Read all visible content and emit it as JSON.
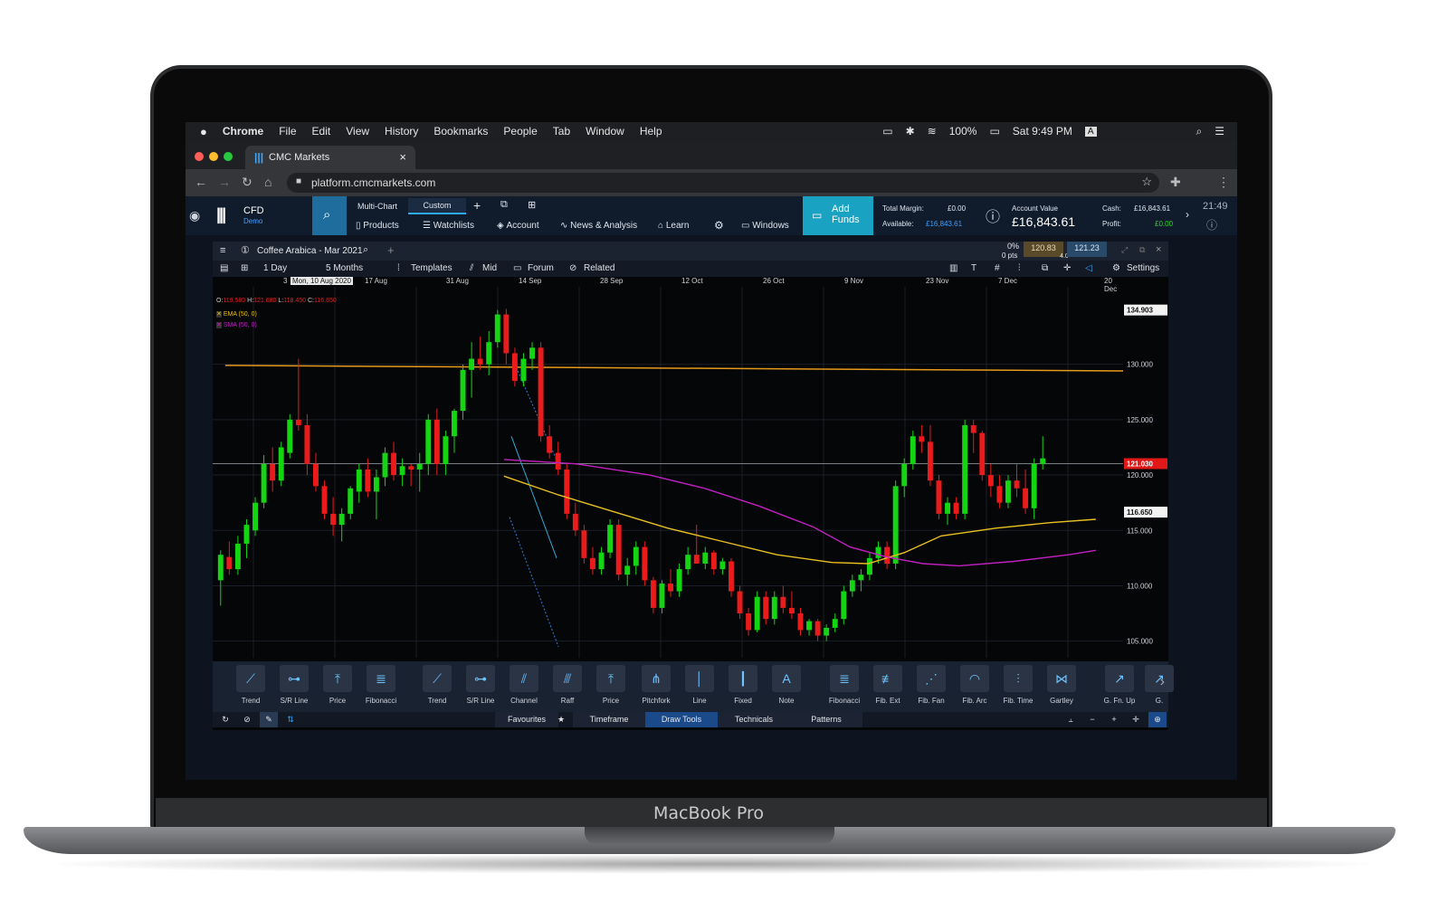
{
  "device": {
    "brand": "MacBook Pro"
  },
  "mac_menu": {
    "apple": "",
    "items": [
      "Chrome",
      "File",
      "Edit",
      "View",
      "History",
      "Bookmarks",
      "People",
      "Tab",
      "Window",
      "Help"
    ],
    "battery": "100%",
    "clock": "Sat 9:49 PM",
    "input": "A"
  },
  "browser": {
    "tab_title": "CMC Markets",
    "tab_close": "×",
    "url": "platform.cmcmarkets.com"
  },
  "cmc_header": {
    "account_type": "CFD",
    "account_mode": "Demo",
    "top_tabs": [
      "Multi-Chart",
      "Custom"
    ],
    "nav": [
      "Products",
      "Watchlists",
      "Account",
      "News & Analysis",
      "Learn",
      "Windows"
    ],
    "add_funds": "Add Funds",
    "total_margin_label": "Total Margin:",
    "total_margin_value": "£0.00",
    "available_label": "Available:",
    "available_value": "£16,843.61",
    "account_value_label": "Account Value",
    "account_value": "£16,843.61",
    "cash_label": "Cash:",
    "cash_value": "£16,843.61",
    "profit_label": "Profit:",
    "profit_value": "£0.00",
    "time": "21:49"
  },
  "chart_window": {
    "instrument": "Coffee Arabica - Mar 2021",
    "change_pct": "0%",
    "change_pts": "0 pts",
    "sell_price": "120.83",
    "buy_price": "121.23",
    "spread": "4.0",
    "toolbar": [
      "1 Day",
      "5 Months",
      "Templates",
      "Mid",
      "Forum",
      "Related",
      "Settings"
    ],
    "date_labels": [
      "3",
      "Mon, 10 Aug 2020",
      "17 Aug",
      "31 Aug",
      "14 Sep",
      "28 Sep",
      "12 Oct",
      "26 Oct",
      "9 Nov",
      "23 Nov",
      "7 Dec",
      "20 Dec"
    ],
    "ohlc": {
      "o_label": "O:",
      "o": "119.580",
      "h_label": "H:",
      "h": "121.680",
      "l_label": "L:",
      "l": "118.450",
      "c_label": "C:",
      "c": "116.650"
    },
    "indicators": [
      {
        "label": "EMA (50, 0)",
        "color": "#e8c020"
      },
      {
        "label": "SMA (50, 0)",
        "color": "#c020c0"
      }
    ],
    "price_labels": [
      "134.903",
      "130.000",
      "125.000",
      "121.030",
      "120.000",
      "116.650",
      "115.000",
      "110.000",
      "105.000"
    ]
  },
  "chart_data": {
    "type": "candlestick",
    "ylim": [
      103.5,
      137
    ],
    "y_ticks": [
      130,
      125,
      120,
      115,
      110,
      105
    ],
    "markers": {
      "high": 134.903,
      "current": 121.03,
      "close": 116.65
    },
    "resistance_line": {
      "from": 129.9,
      "to": 129.4
    },
    "candles": [
      [
        110.5,
        113.2,
        108.2,
        112.8
      ],
      [
        112.6,
        114.0,
        111.0,
        111.5
      ],
      [
        111.5,
        114.5,
        111.0,
        113.8
      ],
      [
        113.8,
        116.0,
        112.5,
        115.5
      ],
      [
        115.0,
        118.0,
        114.5,
        117.5
      ],
      [
        117.5,
        121.8,
        117.0,
        121.0
      ],
      [
        121.0,
        122.5,
        118.5,
        119.5
      ],
      [
        119.5,
        123.0,
        119.0,
        122.5
      ],
      [
        122.0,
        125.5,
        121.5,
        125.0
      ],
      [
        125.0,
        130.5,
        124.0,
        124.5
      ],
      [
        124.5,
        125.5,
        120.0,
        121.0
      ],
      [
        121.0,
        122.0,
        118.5,
        119.0
      ],
      [
        119.0,
        119.5,
        116.0,
        116.5
      ],
      [
        116.5,
        118.0,
        114.5,
        115.5
      ],
      [
        115.5,
        117.0,
        114.0,
        116.5
      ],
      [
        116.5,
        119.0,
        116.0,
        118.8
      ],
      [
        118.5,
        121.0,
        117.5,
        120.5
      ],
      [
        120.5,
        121.5,
        118.0,
        118.5
      ],
      [
        118.5,
        120.5,
        116.0,
        119.8
      ],
      [
        119.8,
        122.5,
        119.0,
        122.0
      ],
      [
        122.0,
        123.0,
        119.5,
        120.0
      ],
      [
        120.0,
        121.5,
        119.0,
        120.8
      ],
      [
        120.8,
        121.0,
        119.0,
        120.5
      ],
      [
        120.5,
        122.0,
        118.5,
        121.0
      ],
      [
        121.0,
        125.5,
        120.0,
        125.0
      ],
      [
        125.0,
        126.0,
        120.0,
        121.0
      ],
      [
        121.0,
        124.0,
        120.0,
        123.5
      ],
      [
        123.5,
        126.0,
        122.0,
        125.8
      ],
      [
        125.8,
        130.0,
        125.0,
        129.5
      ],
      [
        129.5,
        132.0,
        127.0,
        130.5
      ],
      [
        130.5,
        132.5,
        129.5,
        130.0
      ],
      [
        130.0,
        133.0,
        129.0,
        132.0
      ],
      [
        132.0,
        134.9,
        131.5,
        134.5
      ],
      [
        134.5,
        135.0,
        130.0,
        131.0
      ],
      [
        131.0,
        131.5,
        128.0,
        128.5
      ],
      [
        128.5,
        131.0,
        128.0,
        130.5
      ],
      [
        130.5,
        132.0,
        129.5,
        131.5
      ],
      [
        131.5,
        132.0,
        123.0,
        123.5
      ],
      [
        123.5,
        124.5,
        121.5,
        122.0
      ],
      [
        122.0,
        123.0,
        120.0,
        120.5
      ],
      [
        120.5,
        121.0,
        116.0,
        116.5
      ],
      [
        116.5,
        117.5,
        114.5,
        115.0
      ],
      [
        115.0,
        115.5,
        112.0,
        112.5
      ],
      [
        112.5,
        113.5,
        111.0,
        111.5
      ],
      [
        111.5,
        113.5,
        111.0,
        113.0
      ],
      [
        113.0,
        116.0,
        112.5,
        115.5
      ],
      [
        115.5,
        116.0,
        110.5,
        111.0
      ],
      [
        111.0,
        112.5,
        110.0,
        111.8
      ],
      [
        111.8,
        114.0,
        111.0,
        113.5
      ],
      [
        113.5,
        114.0,
        110.0,
        110.5
      ],
      [
        110.5,
        110.8,
        107.5,
        108.0
      ],
      [
        108.0,
        110.5,
        107.5,
        110.2
      ],
      [
        110.2,
        111.5,
        109.0,
        109.5
      ],
      [
        109.5,
        112.0,
        109.0,
        111.5
      ],
      [
        111.5,
        113.5,
        111.0,
        112.8
      ],
      [
        112.8,
        115.5,
        112.0,
        112.0
      ],
      [
        112.0,
        113.5,
        111.5,
        113.0
      ],
      [
        113.0,
        113.2,
        111.0,
        111.5
      ],
      [
        111.5,
        112.5,
        111.0,
        112.2
      ],
      [
        112.2,
        112.5,
        109.0,
        109.5
      ],
      [
        109.5,
        110.0,
        107.0,
        107.5
      ],
      [
        107.5,
        108.0,
        105.5,
        106.0
      ],
      [
        106.0,
        109.5,
        105.8,
        109.0
      ],
      [
        109.0,
        109.5,
        106.5,
        107.0
      ],
      [
        107.0,
        109.5,
        106.5,
        109.0
      ],
      [
        109.0,
        110.0,
        107.5,
        108.0
      ],
      [
        108.0,
        109.5,
        107.0,
        107.5
      ],
      [
        107.5,
        108.0,
        105.5,
        106.0
      ],
      [
        106.0,
        107.0,
        105.5,
        106.8
      ],
      [
        106.8,
        107.0,
        105.0,
        105.5
      ],
      [
        105.5,
        106.5,
        105.0,
        106.2
      ],
      [
        106.2,
        107.5,
        105.8,
        107.0
      ],
      [
        107.0,
        110.0,
        106.5,
        109.5
      ],
      [
        109.5,
        111.0,
        109.0,
        110.5
      ],
      [
        110.5,
        111.5,
        109.5,
        111.0
      ],
      [
        111.0,
        113.0,
        110.5,
        112.5
      ],
      [
        112.5,
        114.0,
        112.0,
        113.5
      ],
      [
        113.5,
        114.0,
        111.5,
        112.0
      ],
      [
        112.0,
        119.5,
        111.5,
        119.0
      ],
      [
        119.0,
        121.5,
        118.0,
        121.0
      ],
      [
        121.0,
        124.0,
        120.5,
        123.5
      ],
      [
        123.5,
        124.5,
        122.0,
        123.0
      ],
      [
        123.0,
        124.5,
        119.0,
        119.5
      ],
      [
        119.5,
        120.0,
        116.0,
        116.5
      ],
      [
        116.5,
        118.0,
        115.5,
        117.5
      ],
      [
        117.5,
        118.0,
        116.0,
        116.5
      ],
      [
        116.5,
        125.0,
        116.0,
        124.5
      ],
      [
        124.5,
        125.0,
        122.0,
        123.8
      ],
      [
        123.8,
        124.0,
        119.5,
        120.0
      ],
      [
        120.0,
        121.0,
        118.0,
        119.0
      ],
      [
        119.0,
        120.0,
        117.0,
        117.5
      ],
      [
        117.5,
        120.0,
        117.0,
        119.5
      ],
      [
        119.5,
        121.0,
        118.0,
        118.8
      ],
      [
        118.8,
        120.5,
        116.5,
        117.0
      ],
      [
        117.0,
        121.5,
        116.0,
        121.0
      ],
      [
        121.0,
        123.5,
        120.5,
        121.5
      ]
    ],
    "ema": [
      [
        0.32,
        119.9
      ],
      [
        0.38,
        118.2
      ],
      [
        0.44,
        116.7
      ],
      [
        0.5,
        115.2
      ],
      [
        0.56,
        114.0
      ],
      [
        0.62,
        112.8
      ],
      [
        0.68,
        112.1
      ],
      [
        0.72,
        112.0
      ],
      [
        0.76,
        113.0
      ],
      [
        0.8,
        114.5
      ],
      [
        0.86,
        115.2
      ],
      [
        0.92,
        115.7
      ],
      [
        0.97,
        116.0
      ]
    ],
    "sma": [
      [
        0.32,
        121.4
      ],
      [
        0.4,
        121.0
      ],
      [
        0.48,
        120.0
      ],
      [
        0.54,
        118.8
      ],
      [
        0.6,
        117.2
      ],
      [
        0.66,
        115.3
      ],
      [
        0.7,
        113.5
      ],
      [
        0.74,
        112.6
      ],
      [
        0.78,
        112.0
      ],
      [
        0.82,
        111.8
      ],
      [
        0.88,
        112.2
      ],
      [
        0.94,
        112.8
      ],
      [
        0.97,
        113.2
      ]
    ]
  },
  "draw_tools": {
    "items": [
      "Trend",
      "S/R Line",
      "Price",
      "Fibonacci",
      "Trend",
      "S/R Line",
      "Channel",
      "Raff",
      "Price",
      "Pitchfork",
      "Line",
      "Fixed",
      "Note",
      "Fibonacci",
      "Fib. Ext",
      "Fib. Fan",
      "Fib. Arc",
      "Fib. Time",
      "Gartley",
      "G. Fn. Up",
      "G."
    ],
    "tabs": [
      "Favourites",
      "Timeframe",
      "Draw Tools",
      "Technicals",
      "Patterns"
    ],
    "active_tab": "Draw Tools"
  }
}
